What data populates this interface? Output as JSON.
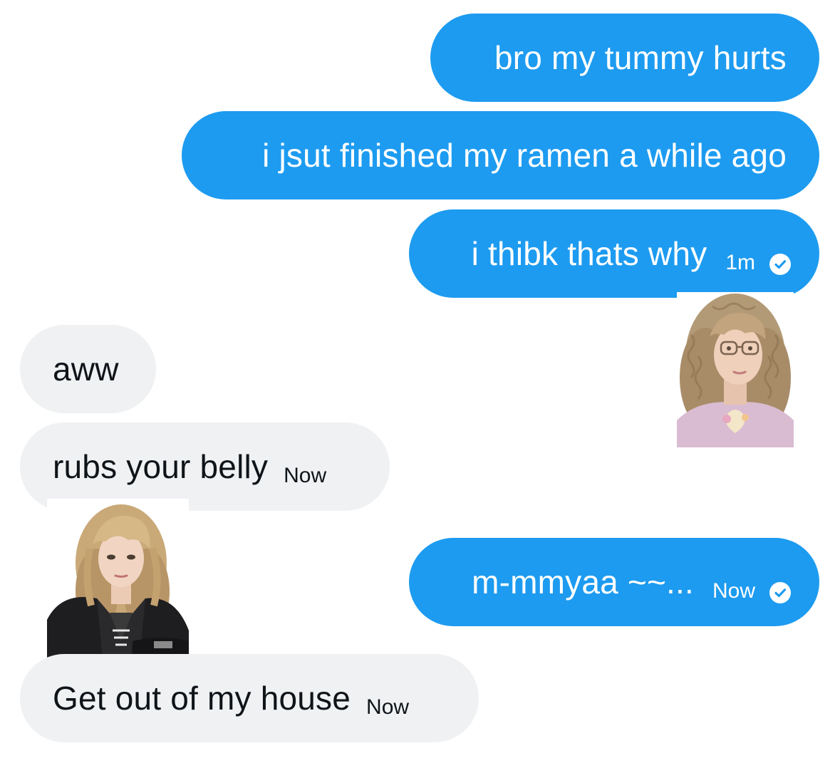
{
  "messages": [
    {
      "side": "outgoing",
      "text": "bro my tummy hurts"
    },
    {
      "side": "outgoing",
      "text": "i jsut finished my ramen a while ago"
    },
    {
      "side": "outgoing",
      "text": "i thibk thats why",
      "time": "1m",
      "status": "read-check-icon"
    },
    {
      "side": "incoming",
      "text": "aww"
    },
    {
      "side": "incoming",
      "text": "rubs your belly",
      "time": "Now"
    },
    {
      "side": "outgoing",
      "text": "m-mmyaa ~~...",
      "time": "Now",
      "status": "read-check-icon"
    },
    {
      "side": "incoming",
      "text": "Get out of my house",
      "time": "Now"
    }
  ],
  "colors": {
    "outgoing_bubble": "#1d9bf0",
    "incoming_bubble": "#eff1f3",
    "outgoing_text": "#ffffff",
    "incoming_text": "#0f1419"
  },
  "avatars": [
    {
      "owner": "outgoing",
      "icon": "curly-blonde-glasses-avatar"
    },
    {
      "owner": "incoming",
      "icon": "blonde-leather-jacket-avatar"
    }
  ]
}
